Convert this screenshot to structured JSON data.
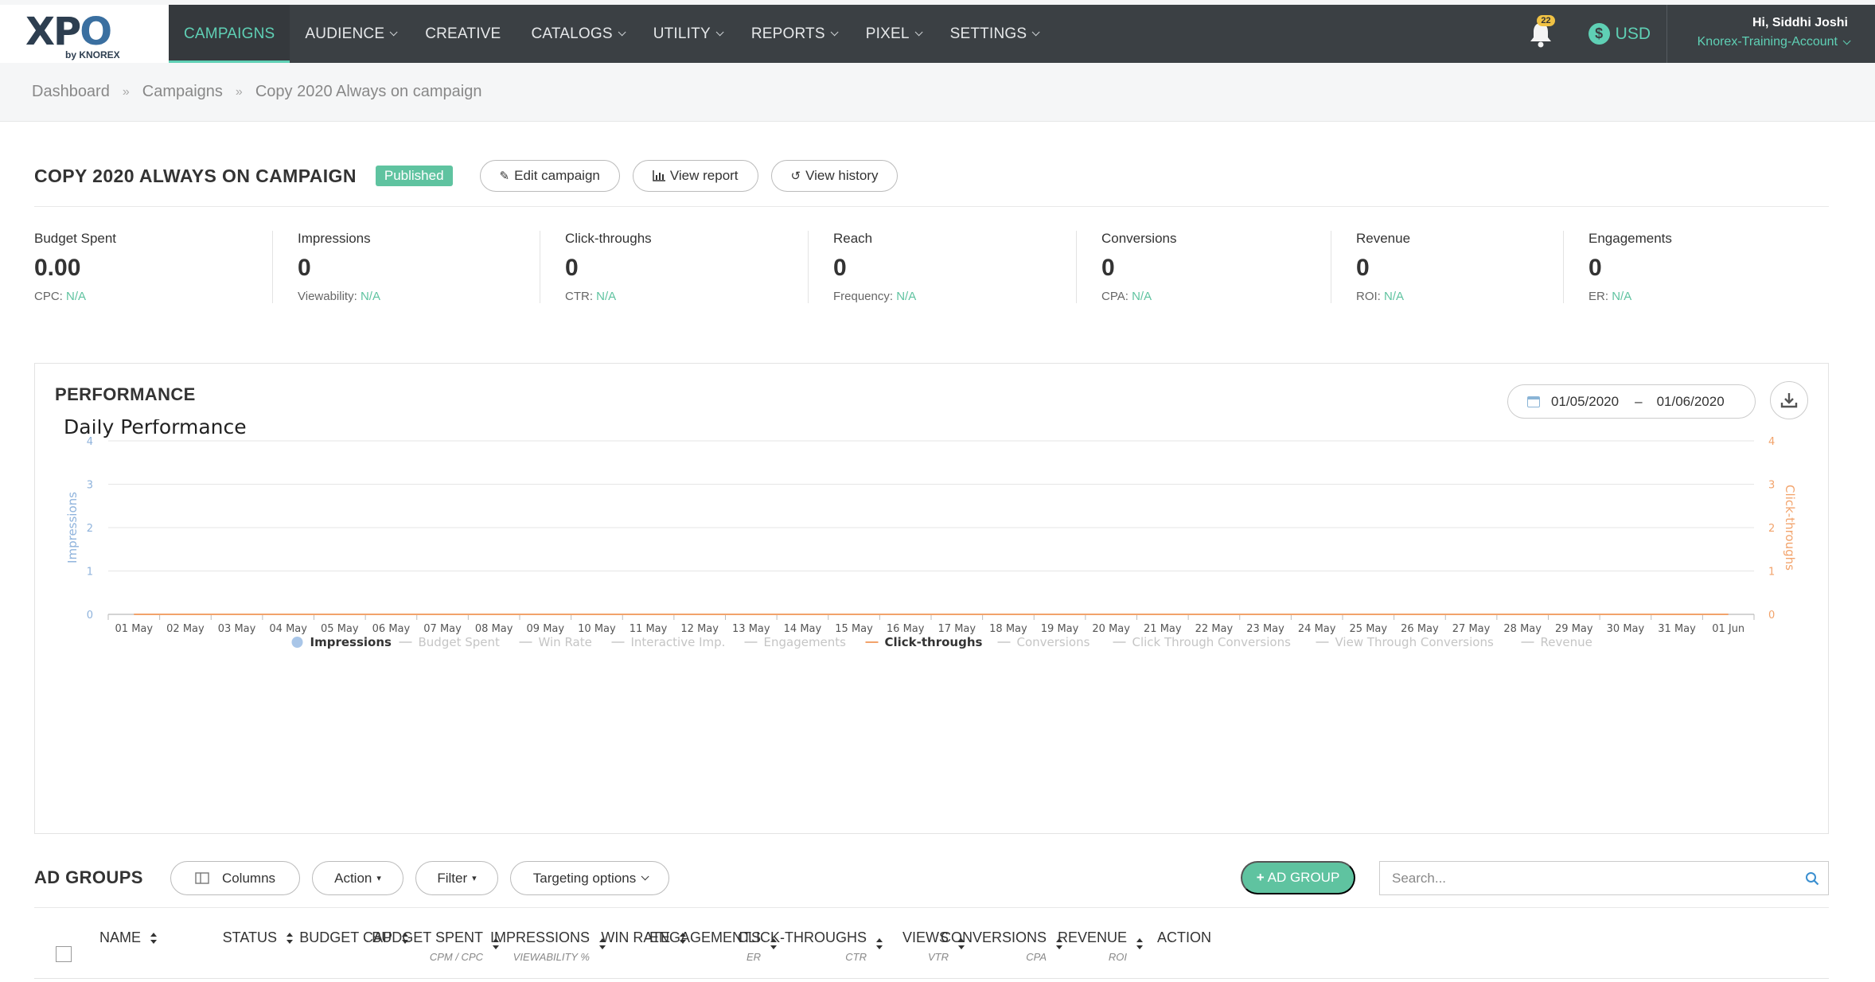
{
  "nav": {
    "logo_text": "XPO",
    "logo_sub": "by KNOREX",
    "items": [
      {
        "label": "CAMPAIGNS",
        "active": true,
        "dropdown": false
      },
      {
        "label": "AUDIENCE",
        "dropdown": true
      },
      {
        "label": "CREATIVE",
        "dropdown": false
      },
      {
        "label": "CATALOGS",
        "dropdown": true
      },
      {
        "label": "UTILITY",
        "dropdown": true
      },
      {
        "label": "REPORTS",
        "dropdown": true
      },
      {
        "label": "PIXEL",
        "dropdown": true
      },
      {
        "label": "SETTINGS",
        "dropdown": true
      }
    ],
    "notifications_count": "22",
    "currency": "USD",
    "currency_symbol": "$",
    "greeting": "Hi, Siddhi Joshi",
    "account": "Knorex-Training-Account"
  },
  "breadcrumb": [
    "Dashboard",
    "Campaigns",
    "Copy 2020 Always on campaign"
  ],
  "breadcrumb_sep": "»",
  "campaign": {
    "title": "COPY 2020 ALWAYS ON CAMPAIGN",
    "status": "Published",
    "edit_label": "Edit campaign",
    "report_label": "View report",
    "history_label": "View history"
  },
  "stats": [
    {
      "label": "Budget Spent",
      "value": "0.00",
      "sub_label": "CPC:",
      "sub_value": "N/A"
    },
    {
      "label": "Impressions",
      "value": "0",
      "sub_label": "Viewability:",
      "sub_value": "N/A"
    },
    {
      "label": "Click-throughs",
      "value": "0",
      "sub_label": "CTR:",
      "sub_value": "N/A"
    },
    {
      "label": "Reach",
      "value": "0",
      "sub_label": "Frequency:",
      "sub_value": "N/A"
    },
    {
      "label": "Conversions",
      "value": "0",
      "sub_label": "CPA:",
      "sub_value": "N/A"
    },
    {
      "label": "Revenue",
      "value": "0",
      "sub_label": "ROI:",
      "sub_value": "N/A"
    },
    {
      "label": "Engagements",
      "value": "0",
      "sub_label": "ER:",
      "sub_value": "N/A"
    }
  ],
  "performance": {
    "title": "PERFORMANCE",
    "date_from": "01/05/2020",
    "date_sep": "–",
    "date_to": "01/06/2020"
  },
  "chart_data": {
    "type": "line",
    "title": "Daily Performance",
    "x": [
      "01 May",
      "02 May",
      "03 May",
      "04 May",
      "05 May",
      "06 May",
      "07 May",
      "08 May",
      "09 May",
      "10 May",
      "11 May",
      "12 May",
      "13 May",
      "14 May",
      "15 May",
      "16 May",
      "17 May",
      "18 May",
      "19 May",
      "20 May",
      "21 May",
      "22 May",
      "23 May",
      "24 May",
      "25 May",
      "26 May",
      "27 May",
      "28 May",
      "29 May",
      "30 May",
      "31 May",
      "01 Jun"
    ],
    "ylabel_left": "Impressions",
    "ylabel_right": "Click-throughs",
    "ylim": [
      0,
      4
    ],
    "yticks": [
      0,
      1,
      2,
      3,
      4
    ],
    "grid": true,
    "legend_position": "bottom",
    "series": [
      {
        "name": "Impressions",
        "active": true,
        "color": "#a9c6e8",
        "values": [
          0,
          0,
          0,
          0,
          0,
          0,
          0,
          0,
          0,
          0,
          0,
          0,
          0,
          0,
          0,
          0,
          0,
          0,
          0,
          0,
          0,
          0,
          0,
          0,
          0,
          0,
          0,
          0,
          0,
          0,
          0,
          0
        ]
      },
      {
        "name": "Budget Spent",
        "active": false
      },
      {
        "name": "Win Rate",
        "active": false
      },
      {
        "name": "Interactive Imp.",
        "active": false
      },
      {
        "name": "Engagements",
        "active": false
      },
      {
        "name": "Click-throughs",
        "active": true,
        "color": "#f2a36b",
        "values": [
          0,
          0,
          0,
          0,
          0,
          0,
          0,
          0,
          0,
          0,
          0,
          0,
          0,
          0,
          0,
          0,
          0,
          0,
          0,
          0,
          0,
          0,
          0,
          0,
          0,
          0,
          0,
          0,
          0,
          0,
          0,
          0
        ]
      },
      {
        "name": "Conversions",
        "active": false
      },
      {
        "name": "Click Through Conversions",
        "active": false
      },
      {
        "name": "View Through Conversions",
        "active": false
      },
      {
        "name": "Revenue",
        "active": false
      }
    ]
  },
  "adgroups": {
    "title": "AD GROUPS",
    "columns_label": "Columns",
    "action_label": "Action",
    "filter_label": "Filter",
    "targeting_label": "Targeting options",
    "add_label": "AD GROUP",
    "search_placeholder": "Search...",
    "headers": [
      {
        "label": "NAME",
        "sub": ""
      },
      {
        "label": "STATUS",
        "sub": ""
      },
      {
        "label": "BUDGET CAP",
        "sub": ""
      },
      {
        "label": "BUDGET SPENT",
        "sub": "CPM / CPC"
      },
      {
        "label": "IMPRESSIONS",
        "sub": "VIEWABILITY %"
      },
      {
        "label": "WIN RATE",
        "sub": ""
      },
      {
        "label": "ENGAGEMENTS",
        "sub": "ER"
      },
      {
        "label": "CLICK-THROUGHS",
        "sub": "CTR"
      },
      {
        "label": "VIEWS",
        "sub": "VTR"
      },
      {
        "label": "CONVERSIONS",
        "sub": "CPA"
      },
      {
        "label": "REVENUE",
        "sub": "ROI"
      },
      {
        "label": "ACTION",
        "sub": ""
      }
    ]
  }
}
